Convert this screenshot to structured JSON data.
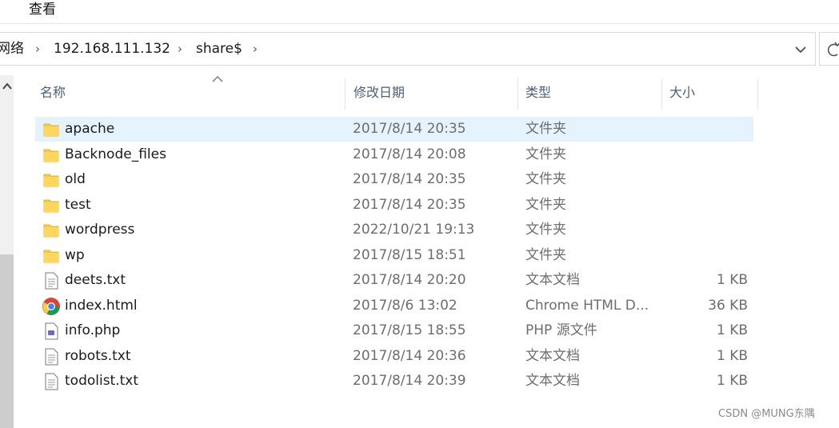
{
  "menu": {
    "view_label": "查看"
  },
  "address": {
    "crumbs": [
      "网络",
      "192.168.111.132",
      "share$"
    ]
  },
  "columns": {
    "name": "名称",
    "date": "修改日期",
    "type": "类型",
    "size": "大小"
  },
  "files": [
    {
      "name": "apache",
      "date": "2017/8/14 20:35",
      "type": "文件夹",
      "size": "",
      "icon": "folder-icon",
      "selected": true
    },
    {
      "name": "Backnode_files",
      "date": "2017/8/14 20:08",
      "type": "文件夹",
      "size": "",
      "icon": "folder-icon"
    },
    {
      "name": "old",
      "date": "2017/8/14 20:35",
      "type": "文件夹",
      "size": "",
      "icon": "folder-icon"
    },
    {
      "name": "test",
      "date": "2017/8/14 20:35",
      "type": "文件夹",
      "size": "",
      "icon": "folder-icon"
    },
    {
      "name": "wordpress",
      "date": "2022/10/21 19:13",
      "type": "文件夹",
      "size": "",
      "icon": "folder-icon"
    },
    {
      "name": "wp",
      "date": "2017/8/15 18:51",
      "type": "文件夹",
      "size": "",
      "icon": "folder-icon"
    },
    {
      "name": "deets.txt",
      "date": "2017/8/14 20:20",
      "type": "文本文档",
      "size": "1 KB",
      "icon": "text-file-icon"
    },
    {
      "name": "index.html",
      "date": "2017/8/6 13:02",
      "type": "Chrome HTML D...",
      "size": "36 KB",
      "icon": "chrome-icon"
    },
    {
      "name": "info.php",
      "date": "2017/8/15 18:55",
      "type": "PHP 源文件",
      "size": "1 KB",
      "icon": "php-file-icon"
    },
    {
      "name": "robots.txt",
      "date": "2017/8/14 20:36",
      "type": "文本文档",
      "size": "1 KB",
      "icon": "text-file-icon"
    },
    {
      "name": "todolist.txt",
      "date": "2017/8/14 20:39",
      "type": "文本文档",
      "size": "1 KB",
      "icon": "text-file-icon"
    }
  ],
  "watermark": "CSDN @MUNG东隅",
  "colors": {
    "selected_row": "#e5f3ff",
    "folder": "#f7c948",
    "header_text": "#4c607a"
  }
}
